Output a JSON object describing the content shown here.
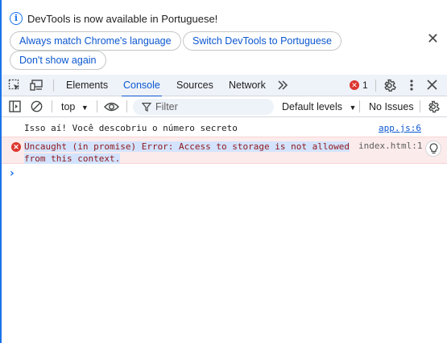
{
  "infobar": {
    "message": "DevTools is now available in Portuguese!",
    "buttons": [
      {
        "label": "Always match Chrome's language"
      },
      {
        "label": "Switch DevTools to Portuguese"
      },
      {
        "label": "Don't show again"
      }
    ],
    "close_icon": "close-icon"
  },
  "tabs": {
    "items": [
      "Elements",
      "Console",
      "Sources",
      "Network"
    ],
    "active": "Console",
    "more_icon": "chevron-double-right-icon",
    "error_count": "1"
  },
  "console_toolbar": {
    "context": "top",
    "filter_placeholder": "Filter",
    "levels": "Default levels",
    "issues": "No Issues"
  },
  "messages": [
    {
      "type": "log",
      "text": "Isso aí! Você descobriu o número secreto",
      "source": "app.js:6"
    },
    {
      "type": "error",
      "text_line1": "Uncaught (in promise) Error: Access to storage is not allowed",
      "text_line2": "from this context.",
      "source": "index.html:1"
    }
  ],
  "colors": {
    "accent": "#0b57d0",
    "error": "#dc362e",
    "error_bg": "#fcebeb",
    "toolbar_bg": "#eef2f9"
  }
}
